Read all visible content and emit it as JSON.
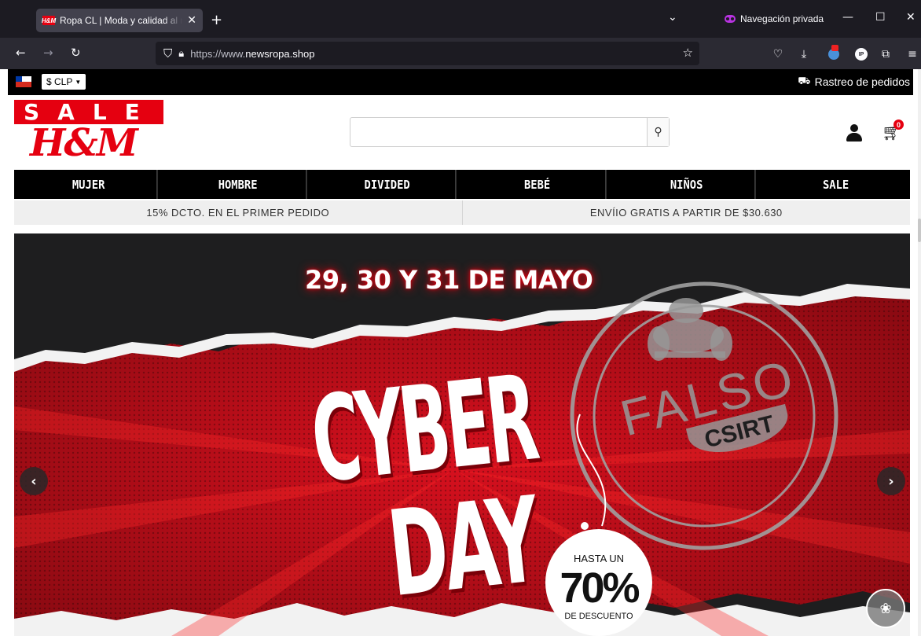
{
  "browser": {
    "tab_title": "Ropa CL | Moda y calidad al mejor precio",
    "tab_favicon_text": "H&M",
    "new_tab_symbol": "+",
    "private_label": "Navegación privada",
    "url_prefix": "https://www.",
    "url_domain": "newsropa.shop",
    "icons": {
      "back": "arrow-left-icon",
      "forward": "arrow-right-icon",
      "reload": "reload-icon",
      "shield": "tracking-protection-icon",
      "lock": "lock-icon",
      "bookmark": "star-icon",
      "pocket": "pocket-icon",
      "downloads": "download-icon",
      "extensions": "puzzle-icon",
      "menu": "hamburger-icon"
    }
  },
  "topbar": {
    "currency": "$ CLP",
    "tracking_label": "Rastreo de pedidos"
  },
  "header": {
    "logo_sale": "SALE",
    "logo_brand": "H&M",
    "search_placeholder": "",
    "cart_count": "0"
  },
  "menu": {
    "items": [
      "MUJER",
      "HOMBRE",
      "DIVIDED",
      "BEBÉ",
      "NIÑOS",
      "SALE"
    ]
  },
  "promo": {
    "left": "15% DCTO. EN EL PRIMER PEDIDO",
    "right": "ENVÍIO GRATIS A PARTIR DE $30.630"
  },
  "hero": {
    "dates": "29, 30 Y 31 DE MAYO",
    "word1": "CYBER",
    "word2": "DAY",
    "tag_top": "HASTA UN",
    "tag_percent": "70%",
    "tag_bottom": "DE DESCUENTO",
    "stamp_word": "FALSO",
    "stamp_org": "CSIRT"
  },
  "colors": {
    "brand_red": "#e50010",
    "browser_dark": "#1c1b22",
    "private_purple": "#b833e1"
  }
}
